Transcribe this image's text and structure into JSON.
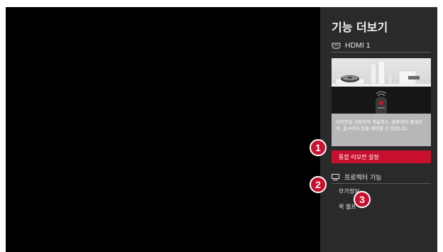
{
  "panel": {
    "title": "기능 더보기",
    "input_label": "HDMI 1",
    "description": "리모컨을 사용하여 셋톱박스, 블루레이 플레이어, 홈시어터 등을 제어할 수 있습니다.",
    "selected_item_label": "통합 리모컨 설정",
    "section_label": "프로젝터 기능",
    "item_info_label": "부가정보",
    "item_quickhelp_label": "퀵 헬프"
  },
  "badges": [
    "1",
    "2",
    "3"
  ],
  "colors": {
    "accent": "#c8102e",
    "panel_bg": "#2a2a2a",
    "screen_bg": "#000000"
  },
  "icons": {
    "input_icon": "hdmi-connector-icon",
    "section_icon": "projector-screen-icon"
  }
}
